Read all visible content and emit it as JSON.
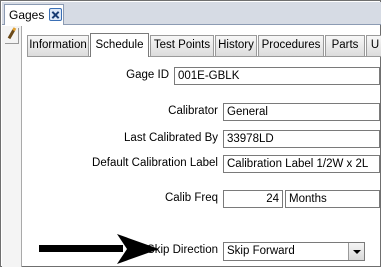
{
  "window": {
    "tab_title": "Gages"
  },
  "tabs": [
    {
      "label": "Information",
      "active": false
    },
    {
      "label": "Schedule",
      "active": true
    },
    {
      "label": "Test Points",
      "active": false
    },
    {
      "label": "History",
      "active": false
    },
    {
      "label": "Procedures",
      "active": false
    },
    {
      "label": "Parts",
      "active": false
    },
    {
      "label": "U",
      "active": false
    }
  ],
  "form": {
    "gage_id": {
      "label": "Gage ID",
      "value": "001E-GBLK"
    },
    "calibrator": {
      "label": "Calibrator",
      "value": "General"
    },
    "last_calibrated_by": {
      "label": "Last Calibrated By",
      "value": "33978LD"
    },
    "default_calibration_label": {
      "label": "Default Calibration Label",
      "value": "Calibration Label 1/2W x 2L"
    },
    "calib_freq": {
      "label": "Calib Freq",
      "value": "24",
      "unit": "Months"
    },
    "skip_direction": {
      "label": "Skip Direction",
      "value": "Skip Forward"
    }
  },
  "icons": {
    "record_indicator": "pencil-icon",
    "close": "close-icon",
    "dropdown": "chevron-down-icon",
    "annotation": "arrow-right-icon"
  }
}
